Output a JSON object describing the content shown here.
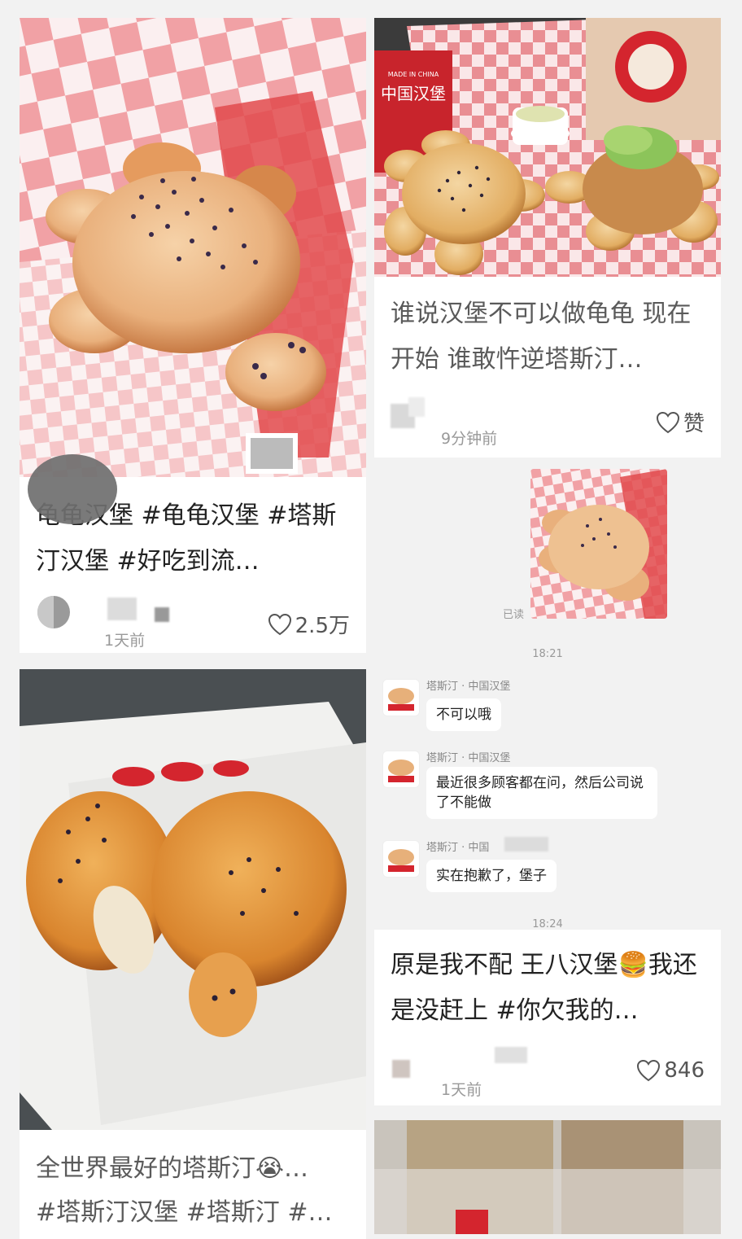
{
  "cards": {
    "c1": {
      "title": "龟龟汉堡 #龟龟汉堡 #塔斯汀汉堡 #好吃到流…",
      "time": "1天前",
      "likes": "2.5万"
    },
    "c2": {
      "title": "谁说汉堡不可以做龟龟 现在开始 谁敢忤逆塔斯汀…",
      "time": "9分钟前",
      "likes": "赞",
      "photo_texts": {
        "bag_line": "MADE IN CHINA",
        "bag_brand": "中国汉堡"
      }
    },
    "c3": {
      "title": "全世界最好的塔斯汀😭…",
      "title2": "#塔斯汀汉堡 #塔斯汀 #…"
    },
    "c4": {
      "title": "原是我不配 王八汉堡🍔我还是没赶上 #你欠我的…",
      "time": "1天前",
      "likes": "846",
      "chat": {
        "read_label": "已读",
        "stamp1": "18:21",
        "stamp2": "18:24",
        "messages": [
          {
            "sender": "塔斯汀 · 中国汉堡",
            "text": "不可以哦"
          },
          {
            "sender": "塔斯汀 · 中国汉堡",
            "text": "最近很多顾客都在问，然后公司说了不能做"
          },
          {
            "sender": "塔斯汀 · 中国",
            "text": "实在抱歉了，堡子"
          }
        ]
      }
    }
  },
  "colors": {
    "accent_red": "#d4252e",
    "checker_pink": "#f2a3a6",
    "bun": "#e7b07a",
    "text": "#222222",
    "meta": "#999999"
  },
  "icons": [
    "heart-outline-icon"
  ]
}
